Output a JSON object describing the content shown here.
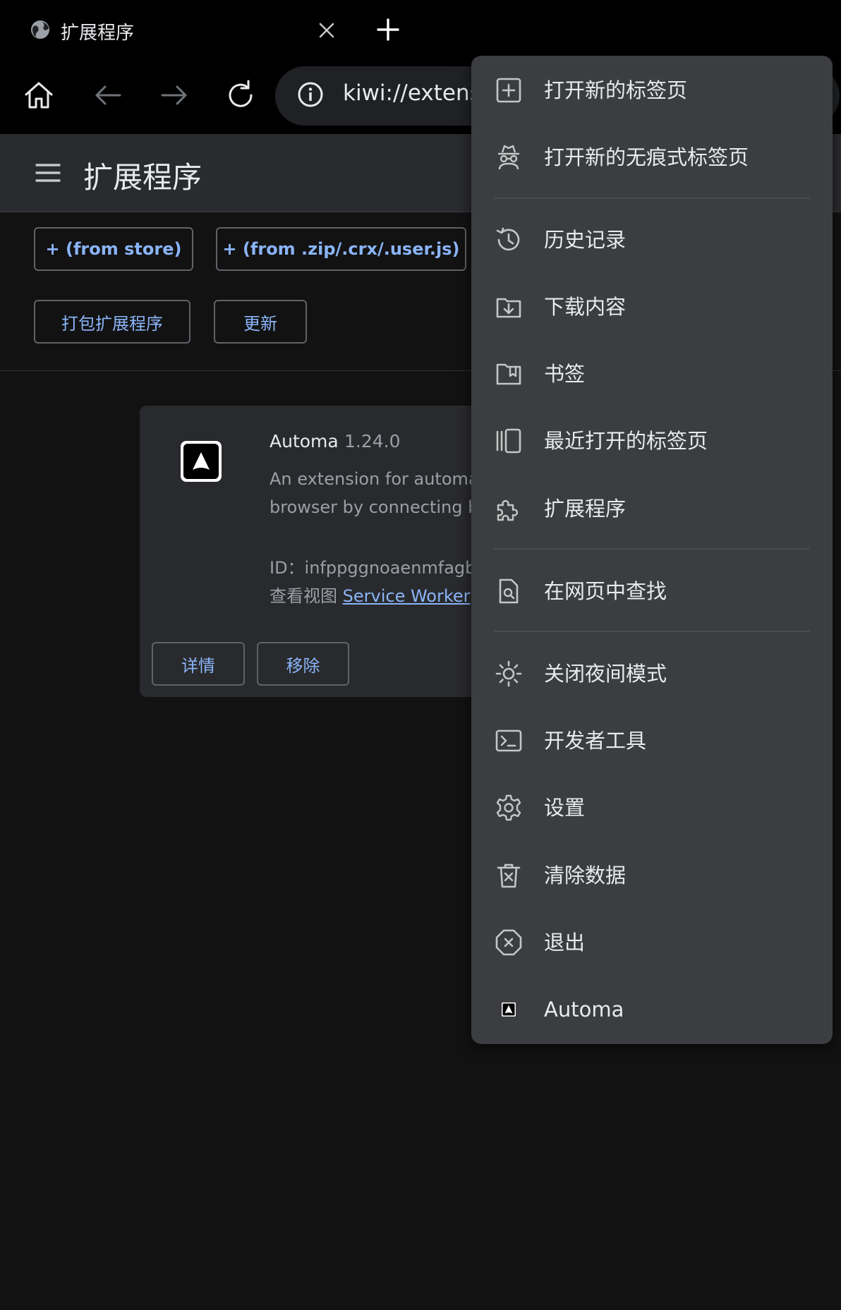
{
  "tab": {
    "title": "扩展程序"
  },
  "omnibox": {
    "url": "kiwi://extensions"
  },
  "page": {
    "title": "扩展程序"
  },
  "actions": {
    "from_store": "+ (from store)",
    "from_file": "+ (from .zip/.crx/.user.js)",
    "pack": "打包扩展程序",
    "update": "更新"
  },
  "extension": {
    "name": "Automa",
    "version": "1.24.0",
    "description": "An extension for automating your browser by connecting blocks",
    "id": "ID：infppggnoaenmfagbfknfkancpbljcca",
    "views_label": "查看视图",
    "views_link": "Service Worker",
    "details_button": "详情",
    "remove_button": "移除"
  },
  "menu": {
    "items": [
      {
        "label": "打开新的标签页",
        "icon": "new-tab-icon"
      },
      {
        "label": "打开新的无痕式标签页",
        "icon": "incognito-icon"
      },
      {
        "label": "历史记录",
        "icon": "history-icon"
      },
      {
        "label": "下载内容",
        "icon": "downloads-icon"
      },
      {
        "label": "书签",
        "icon": "bookmarks-icon"
      },
      {
        "label": "最近打开的标签页",
        "icon": "recent-tabs-icon"
      },
      {
        "label": "扩展程序",
        "icon": "extensions-icon"
      },
      {
        "label": "在网页中查找",
        "icon": "find-in-page-icon"
      },
      {
        "label": "关闭夜间模式",
        "icon": "sun-icon"
      },
      {
        "label": "开发者工具",
        "icon": "terminal-icon"
      },
      {
        "label": "设置",
        "icon": "gear-icon"
      },
      {
        "label": "清除数据",
        "icon": "trash-icon"
      },
      {
        "label": "退出",
        "icon": "exit-icon"
      },
      {
        "label": "Automa",
        "icon": "automa-icon"
      }
    ]
  },
  "colors": {
    "accent": "#8ab4f8",
    "menu_bg": "#3c3d40",
    "page_bg": "#121212"
  }
}
